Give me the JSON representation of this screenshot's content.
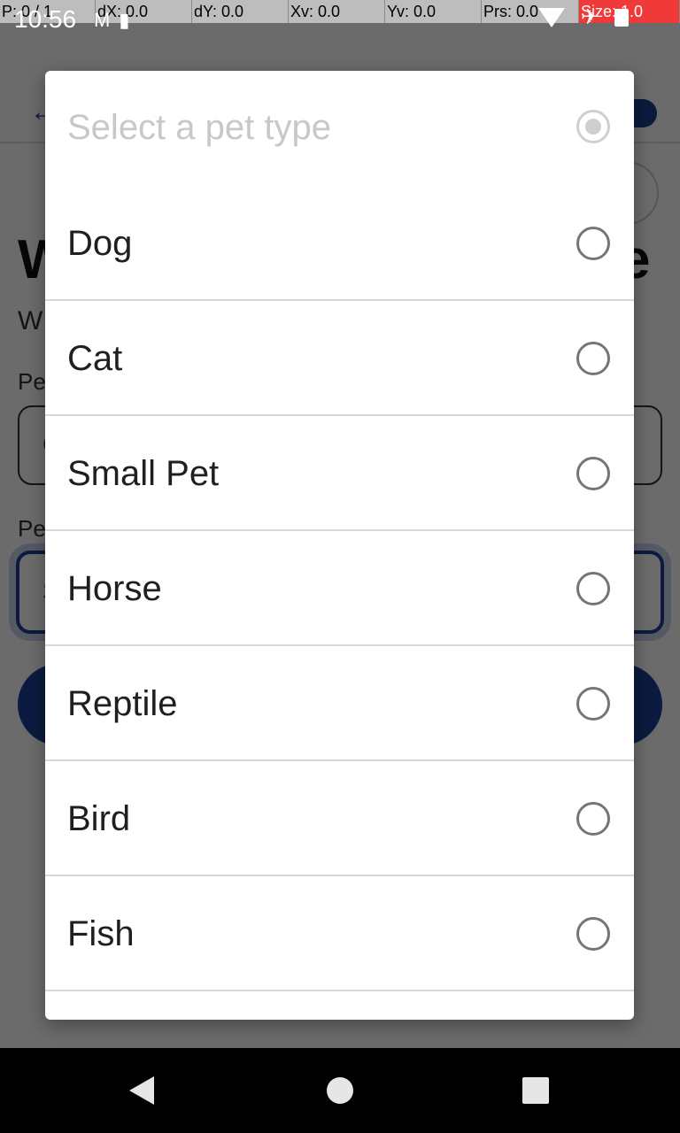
{
  "debug_bar": {
    "cells": [
      "P: 0 / 1",
      "dX: 0.0",
      "dY: 0.0",
      "Xv: 0.0",
      "Yv: 0.0",
      "Prs: 0.0",
      "Size: 1.0"
    ]
  },
  "status_bar": {
    "time": "10:56"
  },
  "background": {
    "title_partial": "W",
    "title_end": "e",
    "subtitle_partial": "W",
    "field1_label_partial": "Pe",
    "field1_value_partial": "C",
    "field2_label_partial": "Pe",
    "field2_value_partial": "S"
  },
  "dialog": {
    "title": "Select a pet type",
    "options": [
      {
        "label": "Dog"
      },
      {
        "label": "Cat"
      },
      {
        "label": "Small Pet"
      },
      {
        "label": "Horse"
      },
      {
        "label": "Reptile"
      },
      {
        "label": "Bird"
      },
      {
        "label": "Fish"
      }
    ]
  },
  "colors": {
    "accent": "#1c3f94",
    "scrim": "#000000",
    "debug_highlight": "#f03a3a"
  }
}
